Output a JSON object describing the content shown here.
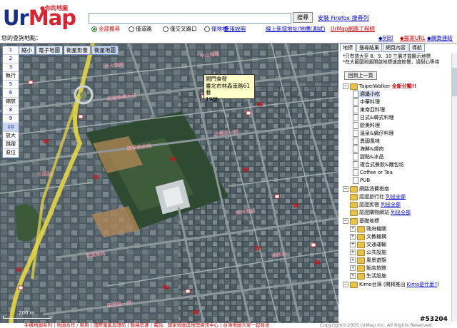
{
  "header": {
    "logo_text_a": "Ur",
    "logo_text_b": "Map",
    "logo_sub": "●你的地圖",
    "search_value": "",
    "search_button": "搜尋",
    "firefox_link": "安裝 Firefox 搜尋列",
    "radios": [
      {
        "label": "全部搜尋",
        "on": true,
        "style": "red"
      },
      {
        "label": "僅道路",
        "on": false,
        "style": ""
      },
      {
        "label": "僅交叉路口",
        "on": false,
        "style": ""
      },
      {
        "label": "僅地標",
        "on": false,
        "style": "blue"
      }
    ],
    "links": [
      {
        "label": "使用說明",
        "style": ""
      },
      {
        "label": "線上新增地址/地標(測試)",
        "style": ""
      },
      {
        "label": "UrMap網路工程師",
        "style": "red"
      }
    ]
  },
  "titlebar": {
    "location_label": "您的查詢地點：",
    "links": [
      {
        "label": "列印",
        "style": ""
      },
      {
        "label": "郵寄URL",
        "style": "red"
      },
      {
        "label": "網頁連結",
        "style": ""
      }
    ]
  },
  "map": {
    "tabs": [
      {
        "label": "縮小",
        "active": false
      },
      {
        "label": "電子地圖",
        "active": false
      },
      {
        "label": "衛星影像",
        "active": false
      },
      {
        "label": "衛星地圖",
        "active": true
      }
    ],
    "zoom": [
      "1",
      "2",
      "3",
      "執行",
      "5",
      "6",
      "縮放",
      "8",
      "9",
      "10",
      "放大",
      "跳躍",
      "原位"
    ],
    "zoom_current": "10",
    "tooltip_line1": "閱門食發",
    "tooltip_line2": "臺北市林森南路61巷",
    "tooltip_line3": "19號",
    "scale_label": "200 m",
    "marker_labels": [
      "W",
      "W",
      "W",
      "W",
      "W",
      "W",
      "W",
      "W",
      "W",
      "W",
      "W",
      "W"
    ]
  },
  "sidebar": {
    "tabs": [
      {
        "label": "地標",
        "active": true
      },
      {
        "label": "搜尋結果",
        "active": false
      },
      {
        "label": "網頁內容",
        "active": false
      },
      {
        "label": "導航",
        "active": false
      }
    ],
    "notice_1": "*只有放大至 8、9、10 三層才能顯示地標",
    "notice_2": "*在大範圍地圖開啟地標速度較慢，請耐心等待",
    "back_button": "回到上一頁",
    "tree": [
      {
        "type": "folder",
        "label": "TaipeiWalker",
        "tag": "全新分類!!",
        "depth": 0
      },
      {
        "type": "doc",
        "label": "週邊小吃",
        "depth": 1,
        "selected": true
      },
      {
        "type": "doc",
        "label": "中華料理",
        "depth": 1
      },
      {
        "type": "doc",
        "label": "東南亞料理",
        "depth": 1
      },
      {
        "type": "doc",
        "label": "日式&韓式料理",
        "depth": 1
      },
      {
        "type": "doc",
        "label": "歐美料理",
        "depth": 1
      },
      {
        "type": "doc",
        "label": "溫泉&鍋仔料理",
        "depth": 1
      },
      {
        "type": "doc",
        "label": "異國風味",
        "depth": 1
      },
      {
        "type": "doc",
        "label": "海鮮&燒肉",
        "depth": 1
      },
      {
        "type": "doc",
        "label": "甜點&冰品",
        "depth": 1
      },
      {
        "type": "doc",
        "label": "複合式餐飲&麵包坊",
        "depth": 1
      },
      {
        "type": "doc",
        "label": "Coffee or Tea",
        "depth": 1
      },
      {
        "type": "doc",
        "label": "PUB",
        "depth": 1
      },
      {
        "type": "folder",
        "label": "網路消費指南",
        "depth": 0
      },
      {
        "type": "folder",
        "label": "認證旅行社",
        "link": "列出全部",
        "depth": 1
      },
      {
        "type": "folder",
        "label": "認證民宿",
        "link": "列出全部",
        "depth": 1
      },
      {
        "type": "folder",
        "label": "認證購物網站",
        "link": "列出全部",
        "depth": 1
      },
      {
        "type": "folder",
        "label": "基礎地標",
        "depth": 0
      },
      {
        "type": "folder",
        "label": "政府機關",
        "depth": 1,
        "pm": "+"
      },
      {
        "type": "folder",
        "label": "文教機構",
        "depth": 1,
        "pm": "+"
      },
      {
        "type": "folder",
        "label": "交通運輸",
        "depth": 1,
        "pm": "+"
      },
      {
        "type": "folder",
        "label": "公共設施",
        "depth": 1,
        "pm": "+"
      },
      {
        "type": "folder",
        "label": "風景遊憩",
        "depth": 1,
        "pm": "+"
      },
      {
        "type": "folder",
        "label": "飯店旅館",
        "depth": 1,
        "pm": "+"
      },
      {
        "type": "folder",
        "label": "生活設施",
        "depth": 1,
        "pm": "+"
      },
      {
        "type": "folder",
        "label": "Kimo台灣 (開將推出",
        "link": "Kimo是什麼?",
        "tail": ")",
        "depth": 0
      }
    ]
  },
  "bottom": {
    "left_text": "手機地圖系列  |  地圖合作 / 租用  |  國際蒐集與導航  |  聯絡宏碁  |  電話：國家地圖與地理資訊中心   |  台灣地圖大家一起發送",
    "right_text": "Copyright©2005 UrMap Inc. All Rights Reserved"
  },
  "watermark": "#53204",
  "colors": {
    "brand_blue": "#1a2f88",
    "brand_red": "#d9232e",
    "link_blue": "#0000cc",
    "marker_red": "#cc1111",
    "road_yellow": "#e6d642"
  }
}
